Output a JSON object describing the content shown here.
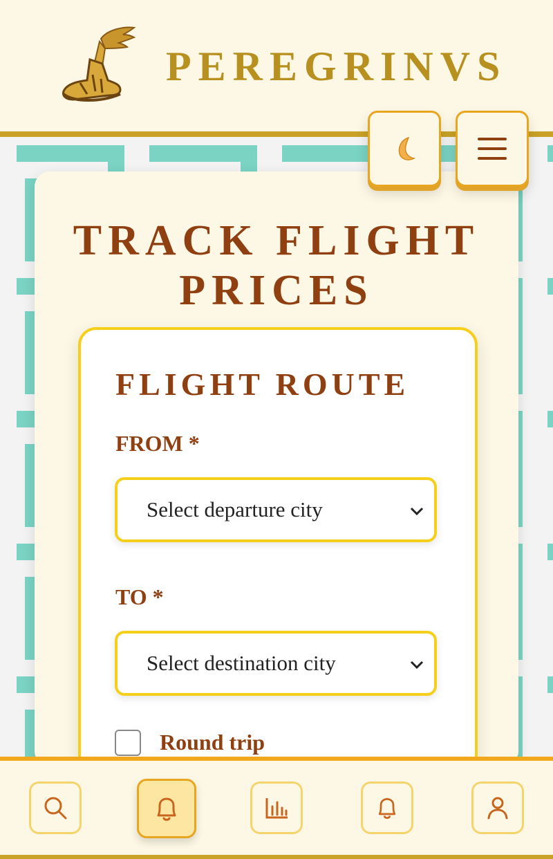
{
  "app": {
    "brand": "PEREGRINVS"
  },
  "page": {
    "title": "TRACK FLIGHT PRICES"
  },
  "route": {
    "section_title": "FLIGHT ROUTE",
    "from_label": "FROM *",
    "from_value": "Select departure city",
    "to_label": "TO *",
    "to_value": "Select destination city",
    "round_trip_label": "Round trip",
    "round_trip_checked": false
  },
  "topbar": {
    "theme_icon": "moon-icon",
    "menu_icon": "hamburger-menu-icon"
  },
  "bottom_nav": {
    "items": [
      {
        "icon": "search-icon",
        "active": false
      },
      {
        "icon": "bell-icon",
        "active": true
      },
      {
        "icon": "bar-chart-icon",
        "active": false
      },
      {
        "icon": "bell-icon",
        "active": false
      },
      {
        "icon": "user-icon",
        "active": false
      }
    ]
  },
  "colors": {
    "brand_gold": "#b8901f",
    "title_brown": "#8f3f10",
    "accent_yellow": "#f5cf1a",
    "pattern_teal": "#7ad3c3",
    "nav_orange": "#f2a81d"
  }
}
